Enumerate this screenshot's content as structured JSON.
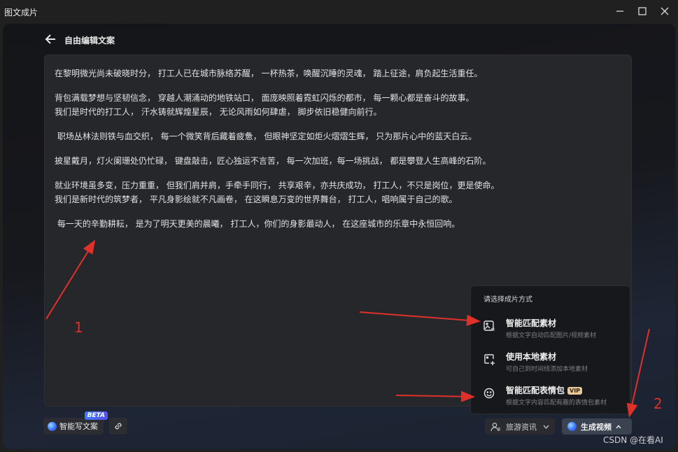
{
  "window": {
    "title": "图文成片"
  },
  "header": {
    "title": "自由编辑文案"
  },
  "editor": {
    "paragraphs": [
      "在黎明微光尚未破晓时分， 打工人已在城市脉络苏醒， 一杯热茶，唤醒沉睡的灵魂， 踏上征途，肩负起生活重任。",
      "背包满载梦想与坚韧信念， 穿越人潮涌动的地铁站口， 面庞映照着霓虹闪烁的都市， 每一颗心都是奋斗的故事。\n我们是时代的打工人， 汗水铸就辉煌星辰， 无论风雨如何肆虐， 脚步依旧稳健向前行。",
      " 职场丛林法则铁与血交织， 每一个微笑背后藏着疲惫， 但眼神坚定如炬火熠熠生辉， 只为那片心中的蓝天白云。",
      "披星戴月，灯火阑珊处仍忙碌， 键盘敲击，匠心独运不言苦， 每一次加班，每一场挑战， 都是攀登人生高峰的石阶。",
      "就业环境虽多变，压力重重， 但我们肩并肩，手牵手同行， 共享艰辛，亦共庆成功， 打工人，不只是岗位，更是使命。\n我们是新时代的筑梦者， 平凡身影绘就不凡画卷， 在这瞬息万变的世界舞台， 打工人，唱响属于自己的歌。",
      " 每一天的辛勤耕耘， 是为了明天更美的晨曦， 打工人，你们的身影最动人， 在这座城市的乐章中永恒回响。"
    ]
  },
  "footer": {
    "ai_write_label": "智能写文案",
    "beta_badge": "BETA",
    "category_label": "旅游资讯",
    "generate_label": "生成视频"
  },
  "menu": {
    "title": "请选择成片方式",
    "items": [
      {
        "label": "智能匹配素材",
        "desc": "根据文字自动匹配图片/视频素材",
        "icon": "ai-image-icon"
      },
      {
        "label": "使用本地素材",
        "desc": "可自己到时间线添加本地素材",
        "icon": "add-image-icon"
      },
      {
        "label": "智能匹配表情包",
        "desc": "根据文字内容匹配有趣的表情包素材",
        "icon": "smile-icon",
        "badge": "VIP"
      }
    ]
  },
  "annotations": {
    "label_1": "1",
    "label_2": "2",
    "color": "#e0302a"
  },
  "watermark": "CSDN @在看AI"
}
